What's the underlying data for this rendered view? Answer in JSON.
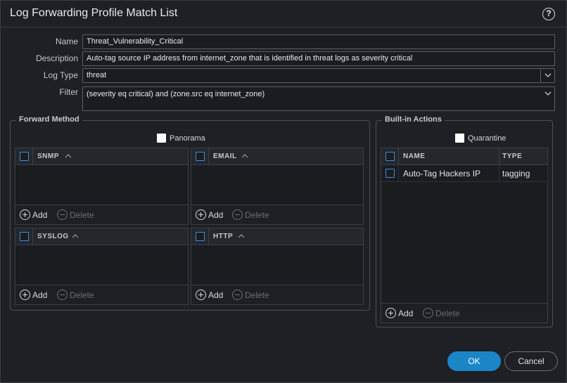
{
  "dialog": {
    "title": "Log Forwarding Profile Match List",
    "help_icon": "?"
  },
  "form": {
    "name_label": "Name",
    "name_value": "Threat_Vulnerability_Critical",
    "description_label": "Description",
    "description_value": "Auto-tag source IP address from internet_zone that is identified in threat logs as severity critical",
    "log_type_label": "Log Type",
    "log_type_value": "threat",
    "filter_label": "Filter",
    "filter_value": "(severity eq critical) and (zone.src eq internet_zone)"
  },
  "forward_method": {
    "legend": "Forward Method",
    "panorama_label": "Panorama",
    "tables": [
      {
        "header": "SNMP"
      },
      {
        "header": "EMAIL"
      },
      {
        "header": "SYSLOG"
      },
      {
        "header": "HTTP"
      }
    ],
    "add_label": "Add",
    "delete_label": "Delete"
  },
  "builtin_actions": {
    "legend": "Built-in Actions",
    "quarantine_label": "Quarantine",
    "columns": {
      "name": "NAME",
      "type": "TYPE"
    },
    "rows": [
      {
        "name": "Auto-Tag Hackers IP",
        "type": "tagging"
      }
    ],
    "add_label": "Add",
    "delete_label": "Delete"
  },
  "buttons": {
    "ok": "OK",
    "cancel": "Cancel"
  },
  "colors": {
    "accent": "#1a86c8",
    "background": "#1e2025",
    "checkbox_border": "#3a8fd9"
  },
  "icons": {
    "sort": "chevron-up-icon",
    "dropdown": "chevron-down-icon",
    "add": "plus-circle-icon",
    "delete": "minus-circle-icon",
    "help": "help-circle-icon"
  }
}
